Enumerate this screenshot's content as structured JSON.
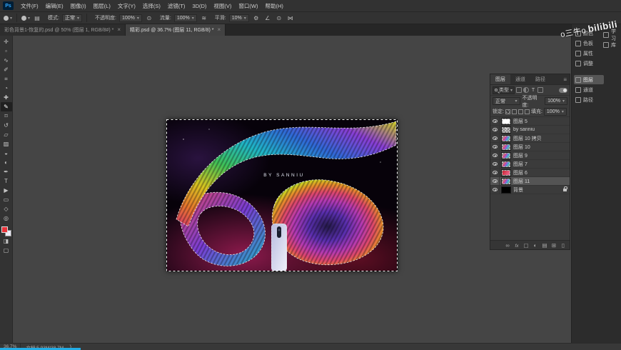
{
  "app": {
    "icon_text": "Ps"
  },
  "menu": {
    "items": [
      "文件(F)",
      "编辑(E)",
      "图像(I)",
      "图层(L)",
      "文字(Y)",
      "选择(S)",
      "滤镜(T)",
      "3D(D)",
      "视图(V)",
      "窗口(W)",
      "帮助(H)"
    ]
  },
  "options": {
    "mode_label": "模式:",
    "mode_value": "正常",
    "opacity_label": "不透明度:",
    "opacity_value": "100%",
    "flow_label": "流量:",
    "flow_value": "100%",
    "smooth_label": "平滑:",
    "smooth_value": "10%"
  },
  "tabs": [
    {
      "title": "彩色背景1-恢复的.psd @ 50% (图层 1, RGB/8#) *",
      "active": false
    },
    {
      "title": "精彩.psd @ 36.7% (图层 11, RGB/8) *",
      "active": true
    }
  ],
  "tools": [
    {
      "name": "move-tool",
      "glyph": "✛"
    },
    {
      "name": "marquee-tool",
      "glyph": "▫"
    },
    {
      "name": "lasso-tool",
      "glyph": "∿"
    },
    {
      "name": "quick-selection-tool",
      "glyph": "✐"
    },
    {
      "name": "crop-tool",
      "glyph": "⌗"
    },
    {
      "name": "eyedropper-tool",
      "glyph": "◔"
    },
    {
      "name": "healing-brush-tool",
      "glyph": "✚"
    },
    {
      "name": "brush-tool",
      "glyph": "✎",
      "active": true
    },
    {
      "name": "clone-stamp-tool",
      "glyph": "⌑"
    },
    {
      "name": "history-brush-tool",
      "glyph": "↺"
    },
    {
      "name": "eraser-tool",
      "glyph": "▱"
    },
    {
      "name": "gradient-tool",
      "glyph": "▨"
    },
    {
      "name": "blur-tool",
      "glyph": "◒"
    },
    {
      "name": "dodge-tool",
      "glyph": "◐"
    },
    {
      "name": "pen-tool",
      "glyph": "✒"
    },
    {
      "name": "type-tool",
      "glyph": "T"
    },
    {
      "name": "path-selection-tool",
      "glyph": "▶"
    },
    {
      "name": "shape-tool",
      "glyph": "▭"
    },
    {
      "name": "hand-tool",
      "glyph": "◇"
    },
    {
      "name": "zoom-tool",
      "glyph": "◎"
    }
  ],
  "layers_panel": {
    "tabs": [
      {
        "label": "图层",
        "active": true
      },
      {
        "label": "通道",
        "active": false
      },
      {
        "label": "路径",
        "active": false
      }
    ],
    "filter": {
      "kind_label": "类型"
    },
    "blend": {
      "mode": "正常",
      "opacity_label": "不透明度:",
      "opacity_value": "100%"
    },
    "lock": {
      "label": "锁定:",
      "fill_label": "填充:",
      "fill_value": "100%"
    },
    "layers": [
      {
        "name": "图层 5",
        "thumb": "white"
      },
      {
        "name": "by sanniu",
        "thumb": "text"
      },
      {
        "name": "图层 10 拷贝",
        "thumb": "art"
      },
      {
        "name": "图层 10",
        "thumb": "art"
      },
      {
        "name": "图层 9",
        "thumb": "art"
      },
      {
        "name": "图层 7",
        "thumb": "art"
      },
      {
        "name": "图层 6",
        "thumb": "red"
      },
      {
        "name": "图层 11",
        "thumb": "art",
        "selected": true
      },
      {
        "name": "背景",
        "thumb": "black",
        "locked": true
      }
    ]
  },
  "dock": {
    "group1": [
      {
        "label": "颜色"
      },
      {
        "label": "色板"
      },
      {
        "label": "属性"
      },
      {
        "label": "调整"
      }
    ],
    "side": [
      {
        "label": "学习"
      },
      {
        "label": "库"
      }
    ],
    "group2": [
      {
        "label": "图层",
        "active": true
      },
      {
        "label": "通道"
      },
      {
        "label": "路径"
      }
    ]
  },
  "canvas": {
    "art_text": "BY SANNIU"
  },
  "status": {
    "zoom": "36.7%",
    "doc": "文档:5.93M/38.7M"
  },
  "watermark": {
    "user": "o三牛o",
    "brand": "bilibili"
  }
}
